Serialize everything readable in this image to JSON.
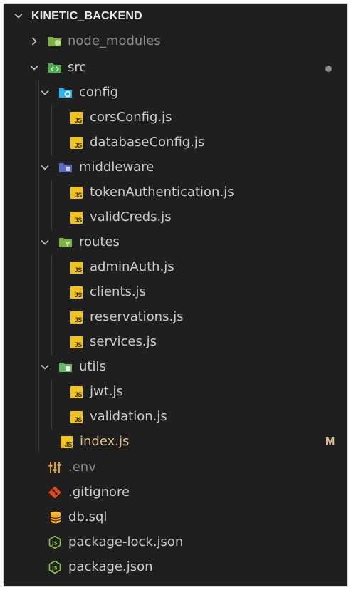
{
  "explorer": {
    "root_name": "KINETIC_BACKEND",
    "colors": {
      "background": "#1f1f1f",
      "text": "#cccccc",
      "dimmed_text": "#8c8c8c",
      "modified_text": "#e2c08d",
      "js_badge": "#f1c31d",
      "folder_green": "#8bc34a",
      "folder_blue": "#42a5f5",
      "folder_config": "#29b6f6",
      "folder_middleware": "#5c6bc0",
      "git_icon": "#e64a19",
      "json_icon": "#8bc34a",
      "db_icon": "#fbc02d"
    },
    "items": [
      {
        "label": "node_modules",
        "kind": "folder",
        "icon": "node-folder-icon",
        "expanded": false,
        "dimmed": true
      },
      {
        "label": "src",
        "kind": "folder",
        "icon": "src-folder-icon",
        "expanded": true,
        "status_dot": true
      },
      {
        "label": "config",
        "kind": "folder",
        "icon": "config-folder-icon",
        "expanded": true
      },
      {
        "label": "corsConfig.js",
        "kind": "file",
        "icon": "js-file-icon",
        "badge_text": "JS"
      },
      {
        "label": "databaseConfig.js",
        "kind": "file",
        "icon": "js-file-icon",
        "badge_text": "JS"
      },
      {
        "label": "middleware",
        "kind": "folder",
        "icon": "middleware-folder-icon",
        "expanded": true
      },
      {
        "label": "tokenAuthentication.js",
        "kind": "file",
        "icon": "js-file-icon",
        "badge_text": "JS"
      },
      {
        "label": "validCreds.js",
        "kind": "file",
        "icon": "js-file-icon",
        "badge_text": "JS"
      },
      {
        "label": "routes",
        "kind": "folder",
        "icon": "routes-folder-icon",
        "expanded": true
      },
      {
        "label": "adminAuth.js",
        "kind": "file",
        "icon": "js-file-icon",
        "badge_text": "JS"
      },
      {
        "label": "clients.js",
        "kind": "file",
        "icon": "js-file-icon",
        "badge_text": "JS"
      },
      {
        "label": "reservations.js",
        "kind": "file",
        "icon": "js-file-icon",
        "badge_text": "JS"
      },
      {
        "label": "services.js",
        "kind": "file",
        "icon": "js-file-icon",
        "badge_text": "JS"
      },
      {
        "label": "utils",
        "kind": "folder",
        "icon": "utils-folder-icon",
        "expanded": true
      },
      {
        "label": "jwt.js",
        "kind": "file",
        "icon": "js-file-icon",
        "badge_text": "JS"
      },
      {
        "label": "validation.js",
        "kind": "file",
        "icon": "js-file-icon",
        "badge_text": "JS"
      },
      {
        "label": "index.js",
        "kind": "file",
        "icon": "js-file-icon",
        "badge_text": "JS",
        "git_status": "M",
        "modified": true
      },
      {
        "label": ".env",
        "kind": "file",
        "icon": "env-settings-icon",
        "dimmed": true
      },
      {
        "label": ".gitignore",
        "kind": "file",
        "icon": "git-icon"
      },
      {
        "label": "db.sql",
        "kind": "file",
        "icon": "database-icon"
      },
      {
        "label": "package-lock.json",
        "kind": "file",
        "icon": "nodejs-icon"
      },
      {
        "label": "package.json",
        "kind": "file",
        "icon": "nodejs-icon"
      }
    ]
  }
}
